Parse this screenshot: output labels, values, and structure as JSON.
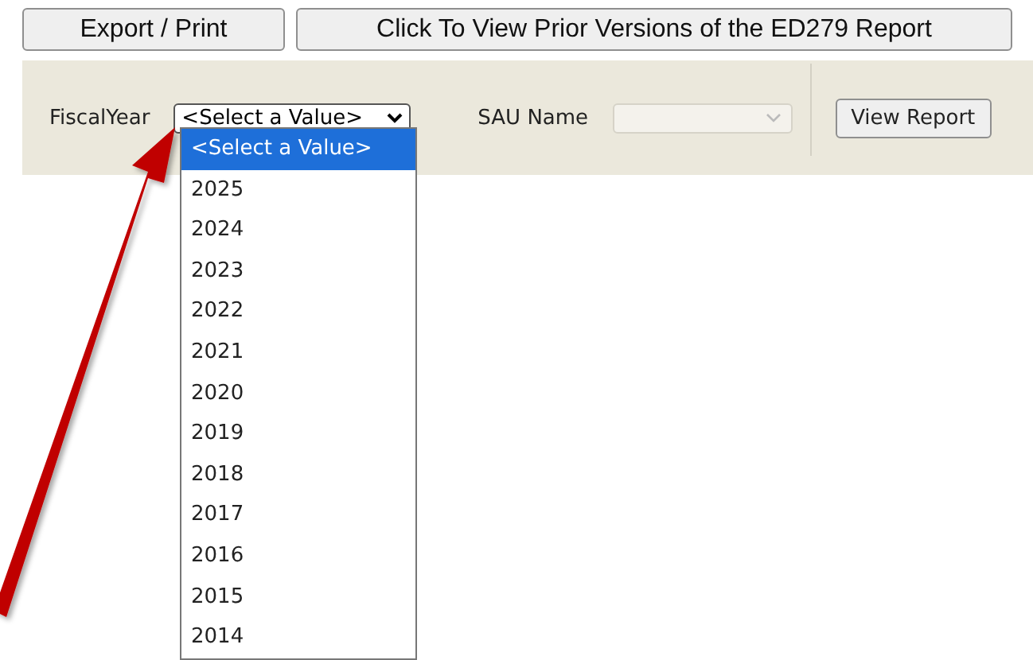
{
  "toolbar": {
    "buttons": [
      "Export / Print",
      "Click To View Prior Versions of the ED279 Report"
    ]
  },
  "parameters": {
    "fiscal_year": {
      "label": "FiscalYear",
      "value": "<Select a Value>",
      "expanded": true
    },
    "sau_name": {
      "label": "SAU Name",
      "disabled": true
    },
    "view_report_button": "View Report"
  },
  "dropdown": {
    "options": [
      {
        "label": "<Select a Value>",
        "selected": true
      },
      {
        "label": "2025",
        "selected": false
      },
      {
        "label": "2024",
        "selected": false
      },
      {
        "label": "2023",
        "selected": false
      },
      {
        "label": "2022",
        "selected": false
      },
      {
        "label": "2021",
        "selected": false
      },
      {
        "label": "2020",
        "selected": false
      },
      {
        "label": "2019",
        "selected": false
      },
      {
        "label": "2018",
        "selected": false
      },
      {
        "label": "2017",
        "selected": false
      },
      {
        "label": "2016",
        "selected": false
      },
      {
        "label": "2015",
        "selected": false
      },
      {
        "label": "2014",
        "selected": false
      }
    ]
  }
}
